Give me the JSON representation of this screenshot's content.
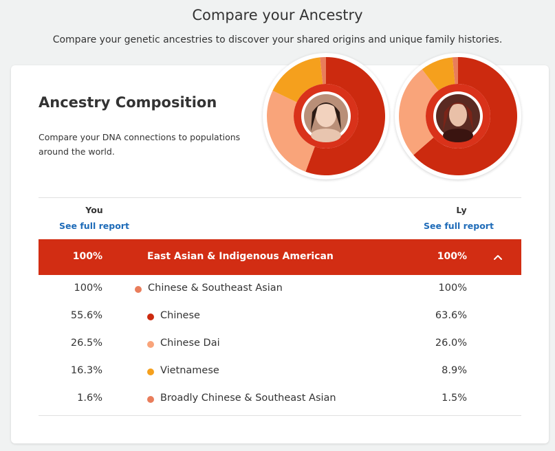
{
  "header": {
    "title": "Compare your Ancestry",
    "subtitle": "Compare your genetic ancestries to discover your shared origins and unique family histories."
  },
  "card": {
    "title": "Ancestry Composition",
    "description": "Compare your DNA connections to populations around the world."
  },
  "colors": {
    "chinese": "#cc2a0f",
    "chinese_dai": "#f9a47a",
    "vietnamese": "#f5a01d",
    "broadly": "#e97d5b",
    "region_bar": "#d22d13",
    "link": "#1e6bb8"
  },
  "people": [
    {
      "label": "You",
      "report_link": "See full report",
      "avatar": "avatar-photo-you"
    },
    {
      "label": "Ly",
      "report_link": "See full report",
      "avatar": "avatar-photo-ly"
    }
  ],
  "composition": {
    "region": {
      "name": "East Asian & Indigenous American",
      "you": "100%",
      "ly": "100%",
      "expanded": true
    },
    "populations": [
      {
        "name": "Chinese & Southeast Asian",
        "you": "100%",
        "ly": "100%",
        "color": "#e97d5b",
        "indent": 0
      },
      {
        "name": "Chinese",
        "you": "55.6%",
        "ly": "63.6%",
        "color": "#cc2a0f",
        "indent": 1
      },
      {
        "name": "Chinese Dai",
        "you": "26.5%",
        "ly": "26.0%",
        "color": "#f9a47a",
        "indent": 1
      },
      {
        "name": "Vietnamese",
        "you": "16.3%",
        "ly": "8.9%",
        "color": "#f5a01d",
        "indent": 1
      },
      {
        "name": "Broadly Chinese & Southeast Asian",
        "you": "1.6%",
        "ly": "1.5%",
        "color": "#e97d5b",
        "indent": 1
      }
    ]
  },
  "donuts": [
    {
      "owner": "You",
      "values": [
        55.6,
        26.5,
        16.3,
        1.6
      ]
    },
    {
      "owner": "Ly",
      "values": [
        63.6,
        26.0,
        8.9,
        1.5
      ]
    }
  ]
}
